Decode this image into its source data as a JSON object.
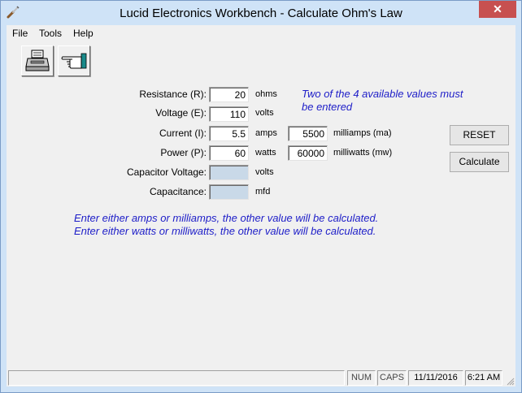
{
  "window": {
    "title": "Lucid Electronics Workbench - Calculate Ohm's Law",
    "close_glyph": "✕"
  },
  "menu": {
    "items": [
      {
        "label": "File"
      },
      {
        "label": "Tools"
      },
      {
        "label": "Help"
      }
    ]
  },
  "toolbar": {
    "buttons": [
      {
        "icon": "printer-icon"
      },
      {
        "icon": "pointing-hand-icon"
      }
    ]
  },
  "form": {
    "resistance": {
      "label": "Resistance (R):",
      "value": "20",
      "unit": "ohms"
    },
    "voltage": {
      "label": "Voltage (E):",
      "value": "110",
      "unit": "volts"
    },
    "current": {
      "label": "Current (I):",
      "value": "5.5",
      "unit": "amps",
      "alt_value": "5500",
      "alt_unit": "milliamps (ma)"
    },
    "power": {
      "label": "Power (P):",
      "value": "60",
      "unit": "watts",
      "alt_value": "60000",
      "alt_unit": "milliwatts (mw)"
    },
    "capacitor_voltage": {
      "label": "Capacitor Voltage:",
      "value": "",
      "unit": "volts"
    },
    "capacitance": {
      "label": "Capacitance:",
      "value": "",
      "unit": "mfd"
    }
  },
  "notes": {
    "required_line1": "Two of the 4 available values must",
    "required_line2": "be entered",
    "line1": "Enter either amps or milliamps, the other value will be calculated.",
    "line2": "Enter either watts or milliwatts, the other value will be calculated."
  },
  "buttons": {
    "reset_label": "RESET",
    "calculate_label": "Calculate"
  },
  "statusbar": {
    "main": "",
    "num": "NUM",
    "caps": "CAPS",
    "date": "11/11/2016",
    "time": "6:21 AM"
  },
  "colors": {
    "note_text": "#1d1dc8",
    "disabled_field": "#c9d9e8",
    "title_bar": "#cfe3f7",
    "close_button": "#c75050"
  }
}
